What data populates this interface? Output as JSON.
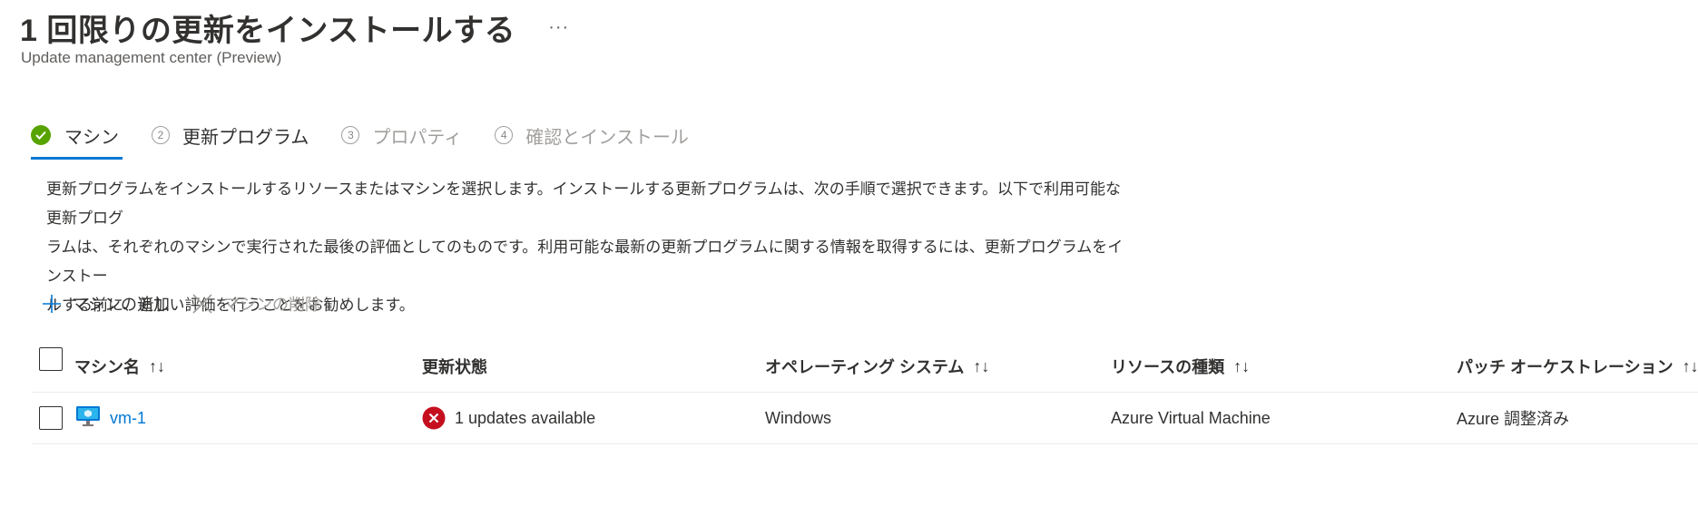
{
  "header": {
    "title": "1 回限りの更新をインストールする",
    "more_label": "···",
    "subtitle": "Update management center (Preview)"
  },
  "steps": [
    {
      "number": "",
      "label": "マシン",
      "state": "completed-active"
    },
    {
      "number": "2",
      "label": "更新プログラム",
      "state": "enabled"
    },
    {
      "number": "3",
      "label": "プロパティ",
      "state": "disabled"
    },
    {
      "number": "4",
      "label": "確認とインストール",
      "state": "disabled"
    }
  ],
  "description": {
    "line1": "更新プログラムをインストールするリソースまたはマシンを選択します。インストールする更新プログラムは、次の手順で選択できます。以下で利用可能な更新プログ",
    "line2": "ラムは、それぞれのマシンで実行された最後の評価としてのものです。利用可能な最新の更新プログラムに関する情報を取得するには、更新プログラムをインストー",
    "line3": "ルする前に、新しい評価を行うことをお勧めします。"
  },
  "toolbar": {
    "add_label": "マシンの追加",
    "remove_label": "マシンの削除"
  },
  "table": {
    "columns": {
      "name": "マシン名",
      "update_status": "更新状態",
      "os": "オペレーティング システム",
      "resource_type": "リソースの種類",
      "patch": "パッチ オーケストレーション"
    },
    "sort_glyph": "↑↓",
    "rows": [
      {
        "name": "vm-1",
        "update_status": "1 updates available",
        "os": "Windows",
        "resource_type": "Azure Virtual Machine",
        "patch": "Azure 調整済み"
      }
    ]
  },
  "colors": {
    "accent": "#0078d4",
    "success": "#57a300",
    "error": "#c50f1f",
    "text": "#323130",
    "disabled": "#a19f9d"
  }
}
